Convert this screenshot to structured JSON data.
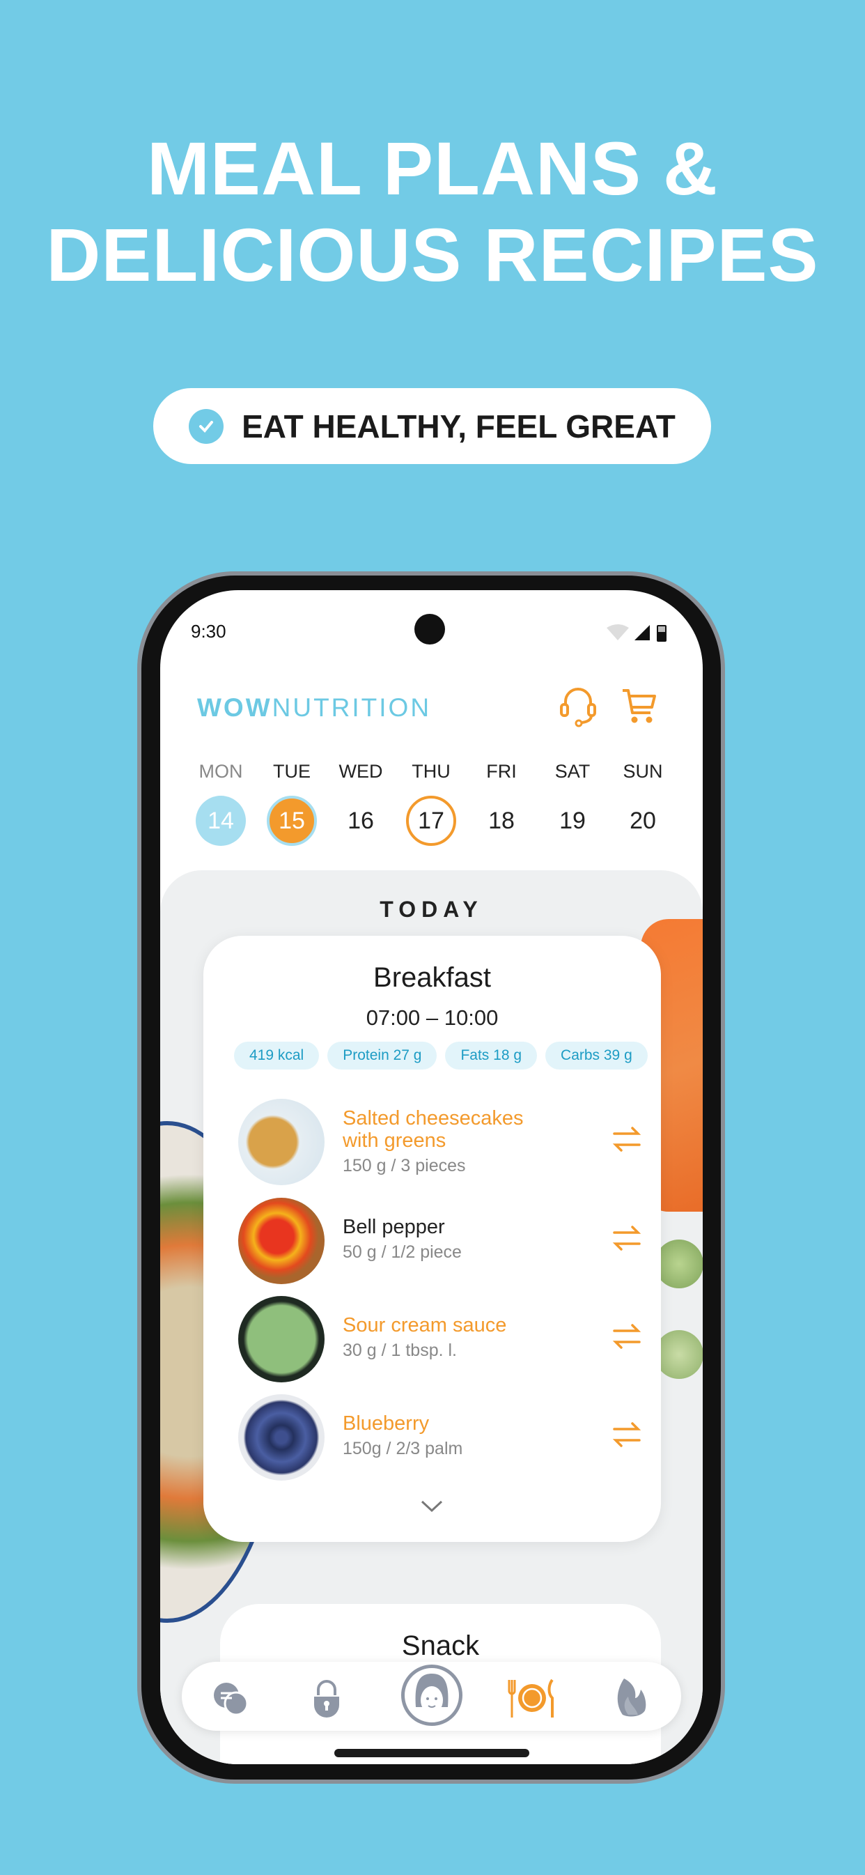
{
  "headline": {
    "line1": "MEAL PLANS &",
    "line2": "DELICIOUS RECIPES"
  },
  "badge": {
    "text": "EAT HEALTHY, FEEL GREAT",
    "icon": "check-circle-icon"
  },
  "status_bar": {
    "time": "9:30"
  },
  "app": {
    "logo_bold": "WOW",
    "logo_light": "NUTRITION",
    "icons": [
      "headset-icon",
      "cart-icon"
    ],
    "accent": "#f39a2c",
    "brand": "#6cc9e3"
  },
  "week": [
    {
      "name": "MON",
      "num": "14",
      "state": "past"
    },
    {
      "name": "TUE",
      "num": "15",
      "state": "selected"
    },
    {
      "name": "WED",
      "num": "16",
      "state": "normal"
    },
    {
      "name": "THU",
      "num": "17",
      "state": "today-outline"
    },
    {
      "name": "FRI",
      "num": "18",
      "state": "normal"
    },
    {
      "name": "SAT",
      "num": "19",
      "state": "normal"
    },
    {
      "name": "SUN",
      "num": "20",
      "state": "normal"
    }
  ],
  "today_label": "TODAY",
  "breakfast": {
    "title": "Breakfast",
    "time": "07:00 – 10:00",
    "chips": [
      "419 kcal",
      "Protein 27 g",
      "Fats 18 g",
      "Carbs 39 g"
    ],
    "items": [
      {
        "name1": "Salted cheesecakes",
        "name2": "with greens",
        "qty": "150 g / 3 pieces"
      },
      {
        "name1": "Bell pepper",
        "name2": "",
        "qty": "50 g / 1/2 piece"
      },
      {
        "name1": "Sour cream sauce",
        "name2": "",
        "qty": "30 g / 1 tbsp. l."
      },
      {
        "name1": "Blueberry",
        "name2": "",
        "qty": "150g / 2/3 palm"
      }
    ]
  },
  "snack": {
    "title": "Snack"
  },
  "nav": {
    "items": [
      "chat-icon",
      "lock-icon",
      "profile-avatar-icon",
      "meal-plate-icon",
      "flame-icon"
    ],
    "active": "meal-plate-icon"
  }
}
